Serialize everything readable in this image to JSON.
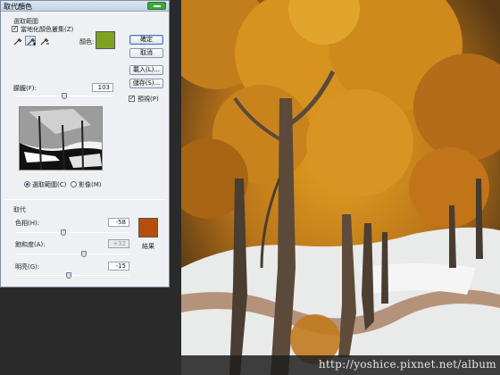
{
  "dialog": {
    "title": "取代顏色",
    "selection_group": "選取範圍",
    "localized_clusters_label": "當地化顏色叢集(Z)",
    "localized_clusters_checked": true,
    "color_label": "顏色:",
    "selected_color": "#7ea321",
    "fuzziness_label": "朦朧(F):",
    "fuzziness_value": "103",
    "fuzziness_level": 0.51,
    "preview_mode_selection": "選取範圍(C)",
    "preview_mode_image": "影像(M)",
    "preview_mode_selected": "selection",
    "replacement_group": "取代",
    "hue_label": "色相(H):",
    "hue_value": "-58",
    "hue_level": 0.42,
    "saturation_label": "飽和度(A):",
    "saturation_value": "+32",
    "saturation_level": 0.6,
    "lightness_label": "明亮(G):",
    "lightness_value": "-15",
    "lightness_level": 0.47,
    "result_label": "結果",
    "result_color": "#b84e0b"
  },
  "buttons": {
    "ok": "確定",
    "cancel": "取消",
    "load": "載入(L)...",
    "save": "儲存(S)...",
    "preview_label": "預視(P)",
    "preview_checked": true
  },
  "icons": {
    "close": "close-icon",
    "eyedropper": "eyedropper-icon",
    "eyedropper_plus": "eyedropper-plus-icon",
    "eyedropper_minus": "eyedropper-minus-icon"
  },
  "watermark": {
    "text": "http://yoshice.pixnet.net/album"
  }
}
